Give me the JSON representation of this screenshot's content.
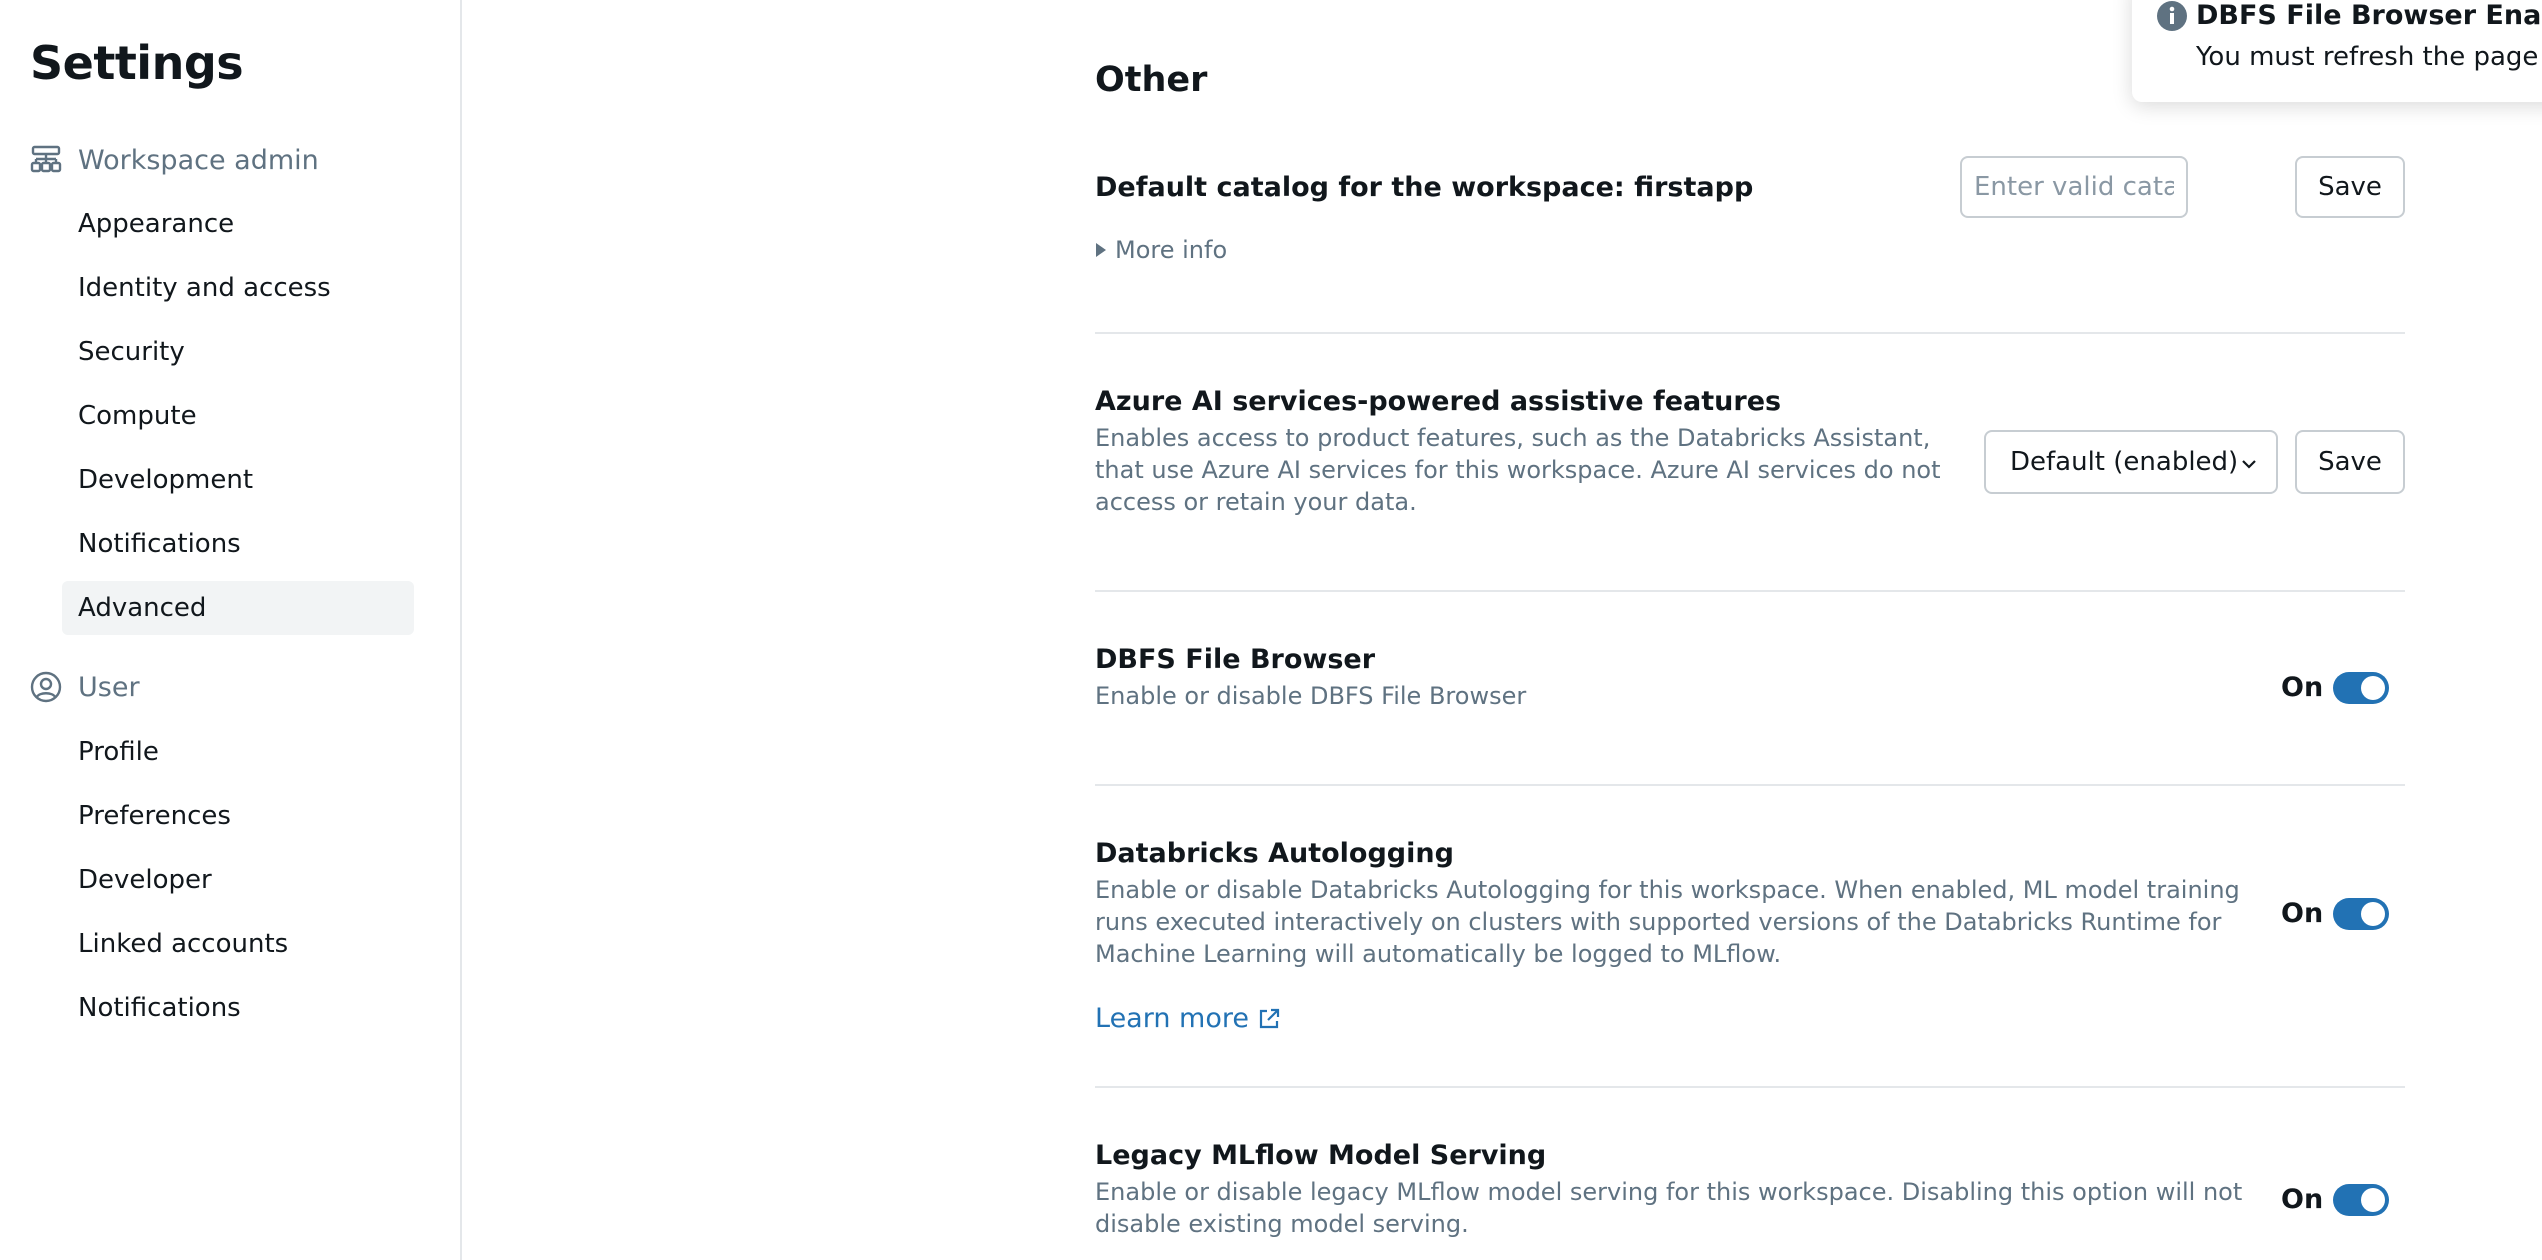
{
  "sidebar": {
    "title": "Settings",
    "workspace_admin": {
      "label": "Workspace admin",
      "items": [
        "Appearance",
        "Identity and access",
        "Security",
        "Compute",
        "Development",
        "Notifications",
        "Advanced"
      ],
      "active": "Advanced"
    },
    "user": {
      "label": "User",
      "items": [
        "Profile",
        "Preferences",
        "Developer",
        "Linked accounts",
        "Notifications"
      ]
    }
  },
  "main": {
    "section_title": "Other",
    "default_catalog": {
      "title": "Default catalog for the workspace: firstapp",
      "input_placeholder": "Enter valid catalog na...",
      "input_value": "",
      "save_label": "Save",
      "more_info": "More info"
    },
    "azure_ai": {
      "title": "Azure AI services-powered assistive features",
      "description": "Enables access to product features, such as the Databricks Assistant, that use Azure AI services for this workspace. Azure AI services do not access or retain your data.",
      "select_value": "Default (enabled)",
      "save_label": "Save"
    },
    "dbfs": {
      "title": "DBFS File Browser",
      "description": "Enable or disable DBFS File Browser",
      "state_label": "On",
      "enabled": true
    },
    "autologging": {
      "title": "Databricks Autologging",
      "description": "Enable or disable Databricks Autologging for this workspace. When enabled, ML model training runs executed interactively on clusters with supported versions of the Databricks Runtime for Machine Learning will automatically be logged to MLflow.",
      "state_label": "On",
      "enabled": true,
      "learn_more": "Learn more"
    },
    "legacy_mlflow": {
      "title": "Legacy MLflow Model Serving",
      "description": "Enable or disable legacy MLflow model serving for this workspace. Disabling this option will not disable existing model serving.",
      "state_label": "On",
      "enabled": true
    }
  },
  "toast": {
    "title": "DBFS File Browser Enabled",
    "message": "You must refresh the page fo"
  },
  "colors": {
    "accent": "#2272b4",
    "muted_text": "#5f7281",
    "border": "#e4e7ea"
  }
}
